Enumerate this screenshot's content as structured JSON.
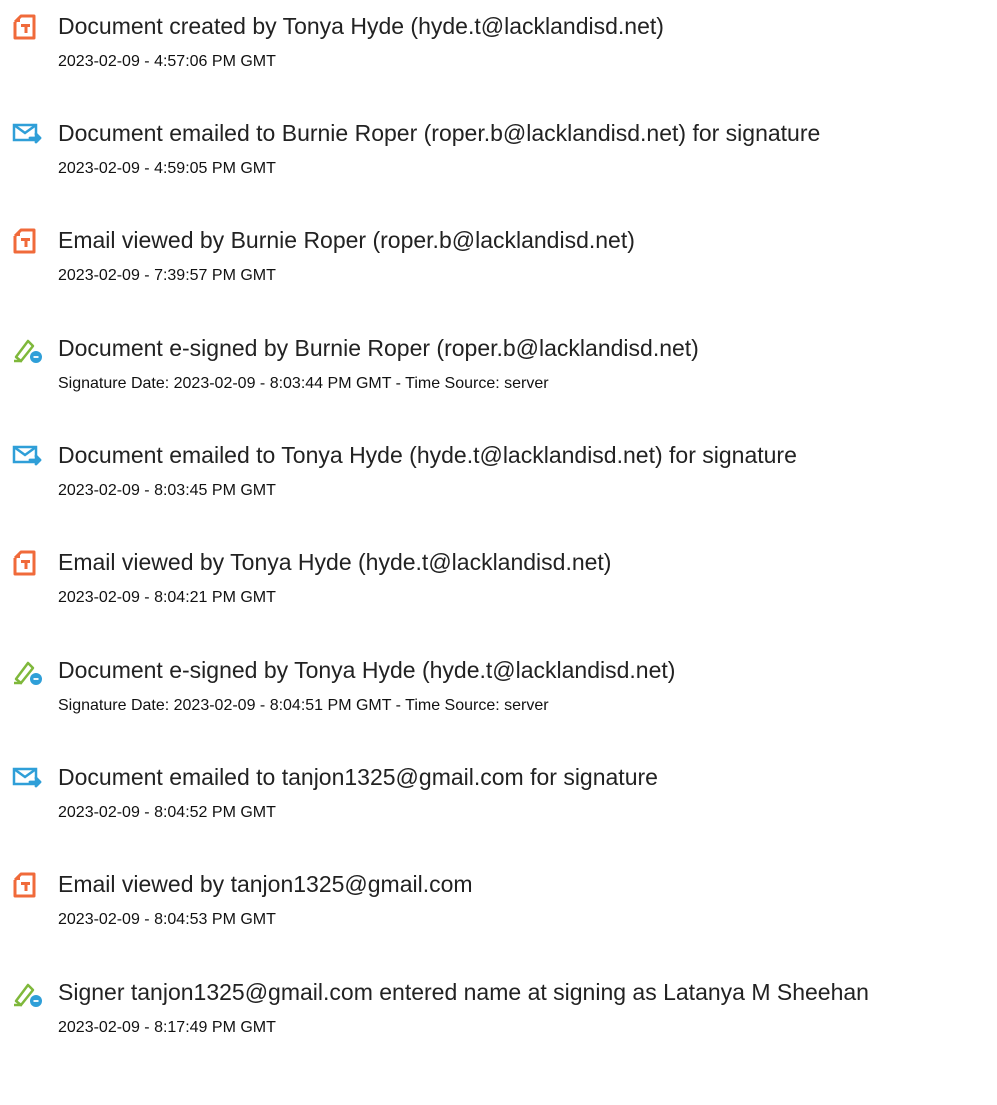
{
  "colors": {
    "doc_icon": "#f06a3a",
    "mail_icon": "#2f9fd8",
    "sign_icon_pen": "#7fb83b",
    "sign_icon_badge": "#2f9fd8"
  },
  "events": [
    {
      "icon": "document-icon",
      "title": "Document created by Tonya Hyde (hyde.t@lacklandisd.net)",
      "detail": "2023-02-09 - 4:57:06 PM GMT"
    },
    {
      "icon": "email-icon",
      "title": "Document emailed to Burnie Roper (roper.b@lacklandisd.net) for signature",
      "detail": "2023-02-09 - 4:59:05 PM GMT"
    },
    {
      "icon": "document-icon",
      "title": "Email viewed by Burnie Roper (roper.b@lacklandisd.net)",
      "detail": "2023-02-09 - 7:39:57 PM GMT"
    },
    {
      "icon": "signature-icon",
      "title": "Document e-signed by Burnie Roper (roper.b@lacklandisd.net)",
      "detail": "Signature Date: 2023-02-09 - 8:03:44 PM GMT - Time Source: server"
    },
    {
      "icon": "email-icon",
      "title": "Document emailed to Tonya Hyde (hyde.t@lacklandisd.net) for signature",
      "detail": "2023-02-09 - 8:03:45 PM GMT"
    },
    {
      "icon": "document-icon",
      "title": "Email viewed by Tonya Hyde (hyde.t@lacklandisd.net)",
      "detail": "2023-02-09 - 8:04:21 PM GMT"
    },
    {
      "icon": "signature-icon",
      "title": "Document e-signed by Tonya Hyde (hyde.t@lacklandisd.net)",
      "detail": "Signature Date: 2023-02-09 - 8:04:51 PM GMT - Time Source: server"
    },
    {
      "icon": "email-icon",
      "title": "Document emailed to tanjon1325@gmail.com for signature",
      "detail": "2023-02-09 - 8:04:52 PM GMT"
    },
    {
      "icon": "document-icon",
      "title": "Email viewed by tanjon1325@gmail.com",
      "detail": "2023-02-09 - 8:04:53 PM GMT"
    },
    {
      "icon": "signature-icon",
      "title": "Signer tanjon1325@gmail.com entered name at signing as Latanya M Sheehan",
      "detail": "2023-02-09 - 8:17:49 PM GMT"
    }
  ]
}
